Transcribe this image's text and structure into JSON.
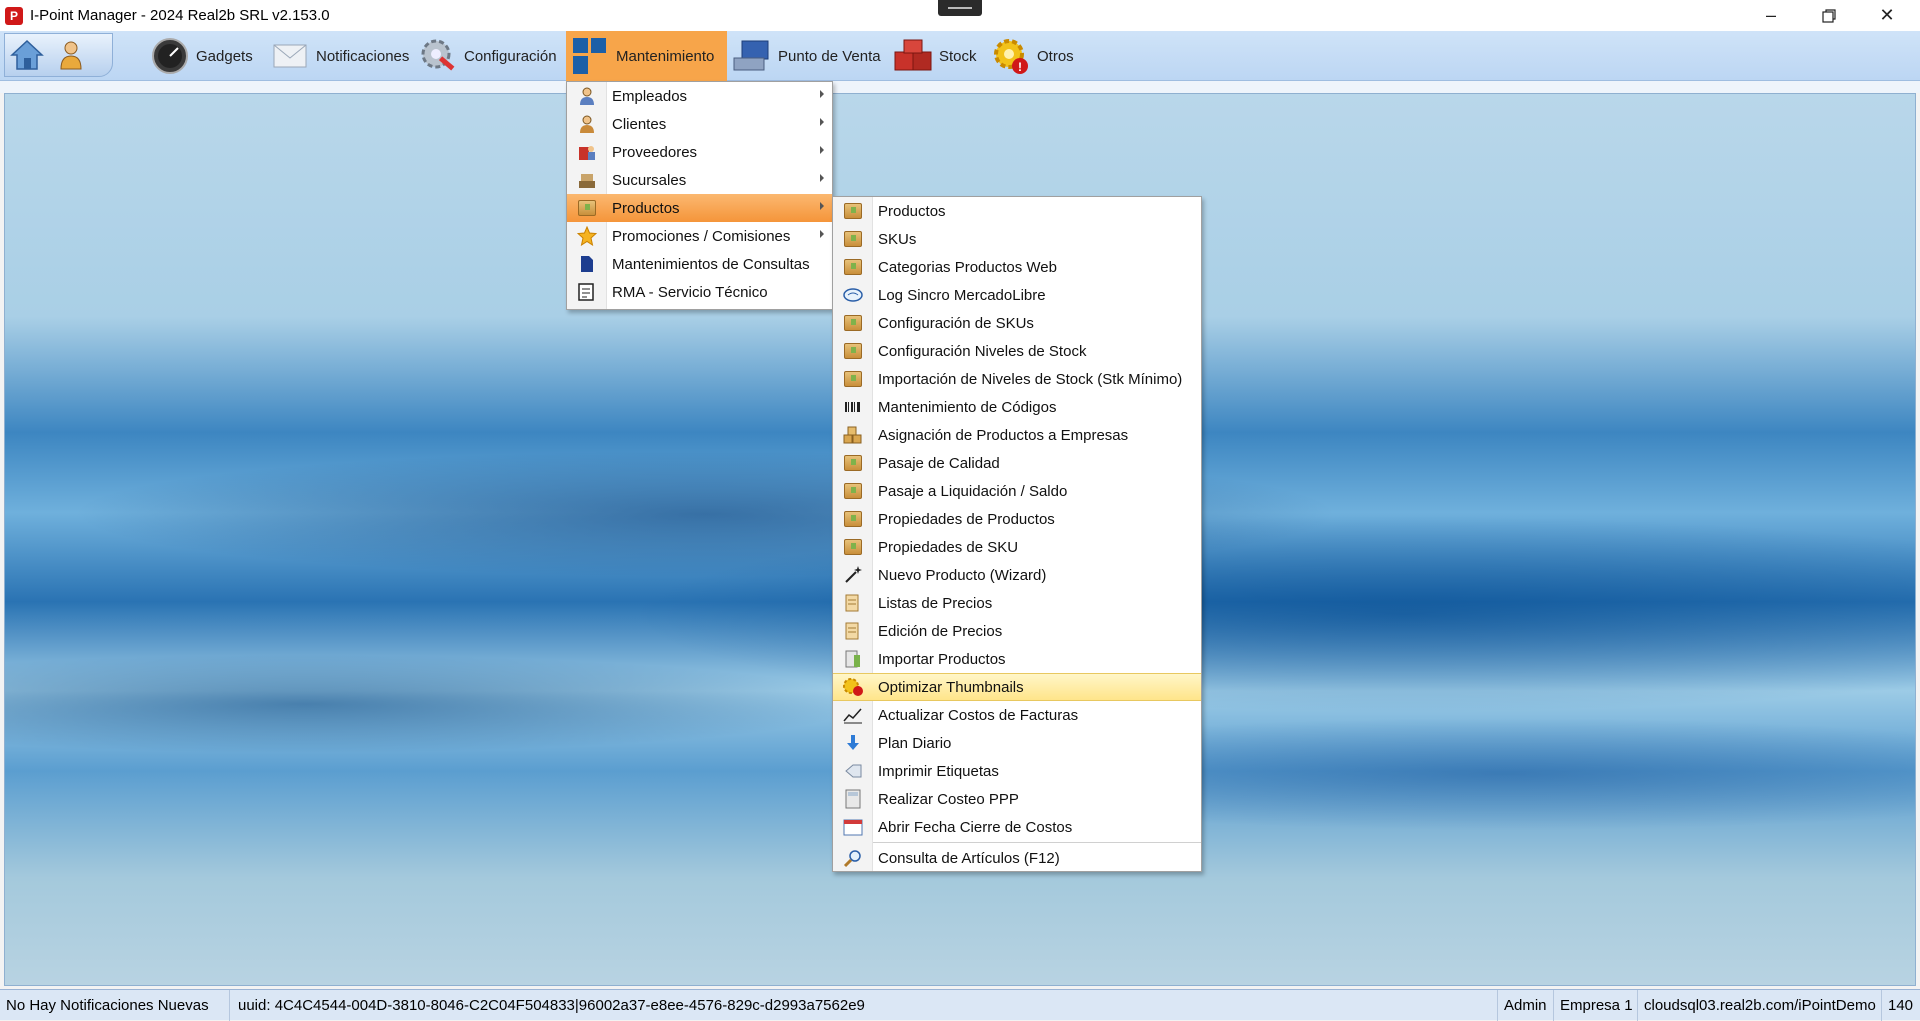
{
  "window": {
    "title": "I-Point Manager - 2024 Real2b SRL v2.153.0",
    "app_icon_letter": "P"
  },
  "toolbar": {
    "items": [
      {
        "label": "Gadgets",
        "icon": "speedometer-icon"
      },
      {
        "label": "Notificaciones",
        "icon": "envelope-icon"
      },
      {
        "label": "Configuración",
        "icon": "gear-wrench-icon"
      },
      {
        "label": "Mantenimiento",
        "icon": "tiles-icon",
        "active": true
      },
      {
        "label": "Punto de Venta",
        "icon": "pos-terminal-icon"
      },
      {
        "label": "Stock",
        "icon": "boxes-icon"
      },
      {
        "label": "Otros",
        "icon": "gear-alert-icon"
      }
    ]
  },
  "menu_mantenimiento": [
    {
      "label": "Empleados",
      "submenu": true
    },
    {
      "label": "Clientes",
      "submenu": true
    },
    {
      "label": "Proveedores",
      "submenu": true
    },
    {
      "label": "Sucursales",
      "submenu": true
    },
    {
      "label": "Productos",
      "submenu": true,
      "highlighted": true
    },
    {
      "label": "Promociones / Comisiones",
      "submenu": true
    },
    {
      "label": "Mantenimientos de Consultas",
      "submenu": false
    },
    {
      "label": "RMA - Servicio Técnico",
      "submenu": false
    }
  ],
  "menu_productos": [
    {
      "label": "Productos"
    },
    {
      "label": "SKUs"
    },
    {
      "label": "Categorias Productos Web"
    },
    {
      "label": "Log Sincro MercadoLibre"
    },
    {
      "label": "Configuración de SKUs"
    },
    {
      "label": "Configuración Niveles de Stock"
    },
    {
      "label": "Importación de Niveles de Stock (Stk Mínimo)"
    },
    {
      "label": "Mantenimiento de Códigos"
    },
    {
      "label": "Asignación de Productos a Empresas"
    },
    {
      "label": "Pasaje de Calidad"
    },
    {
      "label": "Pasaje a Liquidación / Saldo"
    },
    {
      "label": "Propiedades de Productos"
    },
    {
      "label": "Propiedades de SKU"
    },
    {
      "label": "Nuevo Producto (Wizard)"
    },
    {
      "label": "Listas de Precios"
    },
    {
      "label": "Edición de Precios"
    },
    {
      "label": "Importar Productos"
    },
    {
      "label": "Optimizar Thumbnails",
      "highlighted": true
    },
    {
      "label": "Actualizar Costos de Facturas"
    },
    {
      "label": "Plan Diario"
    },
    {
      "label": "Imprimir Etiquetas"
    },
    {
      "label": "Realizar Costeo PPP"
    },
    {
      "label": "Abrir Fecha Cierre de Costos"
    },
    {
      "label": "Consulta de Artículos (F12)",
      "separator_before": true
    }
  ],
  "statusbar": {
    "notifications": "No Hay Notificaciones Nuevas",
    "uuid": "uuid: 4C4C4544-004D-3810-8046-C2C04F504833|96002a37-e8ee-4576-829c-d2993a7562e9",
    "user": "Admin",
    "company": "Empresa 1",
    "server": "cloudsql03.real2b.com/iPointDemo",
    "extra": "140"
  },
  "colors": {
    "active_tab": "#f7a54a",
    "menu_highlight": "#f5953a",
    "hover_highlight": "#ffe58a",
    "toolbar_bg": "#bcd6f3"
  }
}
